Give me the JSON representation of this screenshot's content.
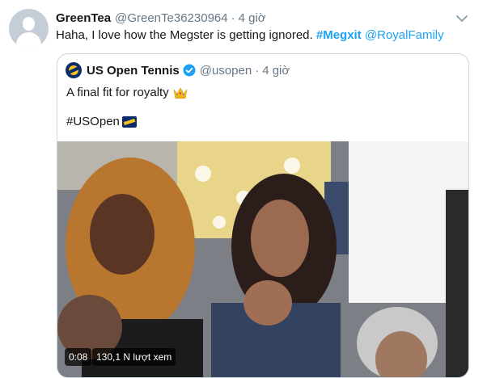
{
  "tweet": {
    "display_name": "GreenTea",
    "handle": "@GreenTe36230964",
    "separator": "·",
    "time": "4 giờ",
    "text_plain": "Haha, I love how the Megster is getting ignored. ",
    "hashtag": "#Megxit",
    "mention": "@RoyalFamily",
    "avatar_icon": "default-avatar-icon",
    "menu_icon": "chevron-down-icon"
  },
  "quote": {
    "display_name": "US Open Tennis",
    "handle": "@usopen",
    "separator": "·",
    "time": "4 giờ",
    "text": "A final fit for royalty",
    "text_emoji": "crown-icon",
    "hashtag": "#USOpen",
    "hashtag_emoji": "usopen-logo-icon",
    "logo_icon": "usopen-logo-icon",
    "verified_icon": "verified-badge-icon"
  },
  "video": {
    "duration": "0:08",
    "views": "130,1 N lượt xem"
  },
  "colors": {
    "link": "#1da1f2",
    "muted": "#657786",
    "text": "#14171a",
    "border": "#ccd6dd"
  }
}
